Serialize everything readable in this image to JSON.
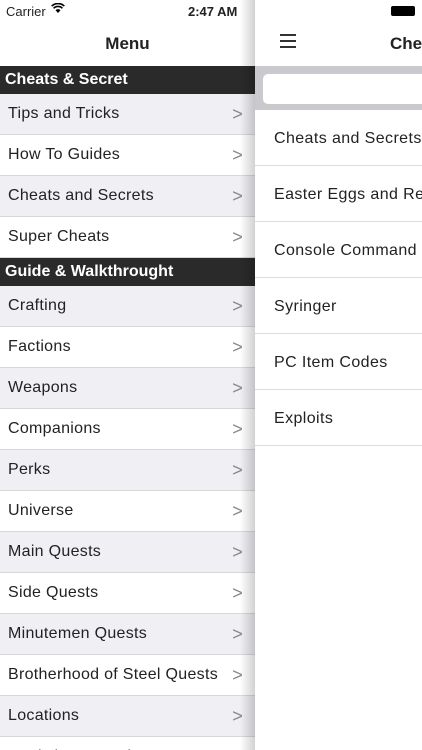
{
  "status": {
    "carrier": "Carrier",
    "time": "2:47 AM"
  },
  "menu": {
    "title": "Menu",
    "sections": [
      {
        "header": "Cheats & Secret",
        "items": [
          "Tips and Tricks",
          "How To Guides",
          "Cheats and Secrets",
          "Super Cheats"
        ]
      },
      {
        "header": "Guide & Walkthrought",
        "items": [
          "Crafting",
          "Factions",
          "Weapons",
          "Companions",
          "Perks",
          "Universe",
          "Main Quests",
          "Side Quests",
          "Minutemen Quests",
          "Brotherhood of Steel Quests",
          "Locations",
          "Workshop Locations"
        ]
      }
    ],
    "chevron": ">"
  },
  "content": {
    "title": "Che",
    "search_placeholder": "",
    "items": [
      "Cheats and Secrets",
      "Easter Eggs and Ref",
      "Console Command C",
      "Syringer",
      "PC Item Codes",
      "Exploits"
    ]
  }
}
